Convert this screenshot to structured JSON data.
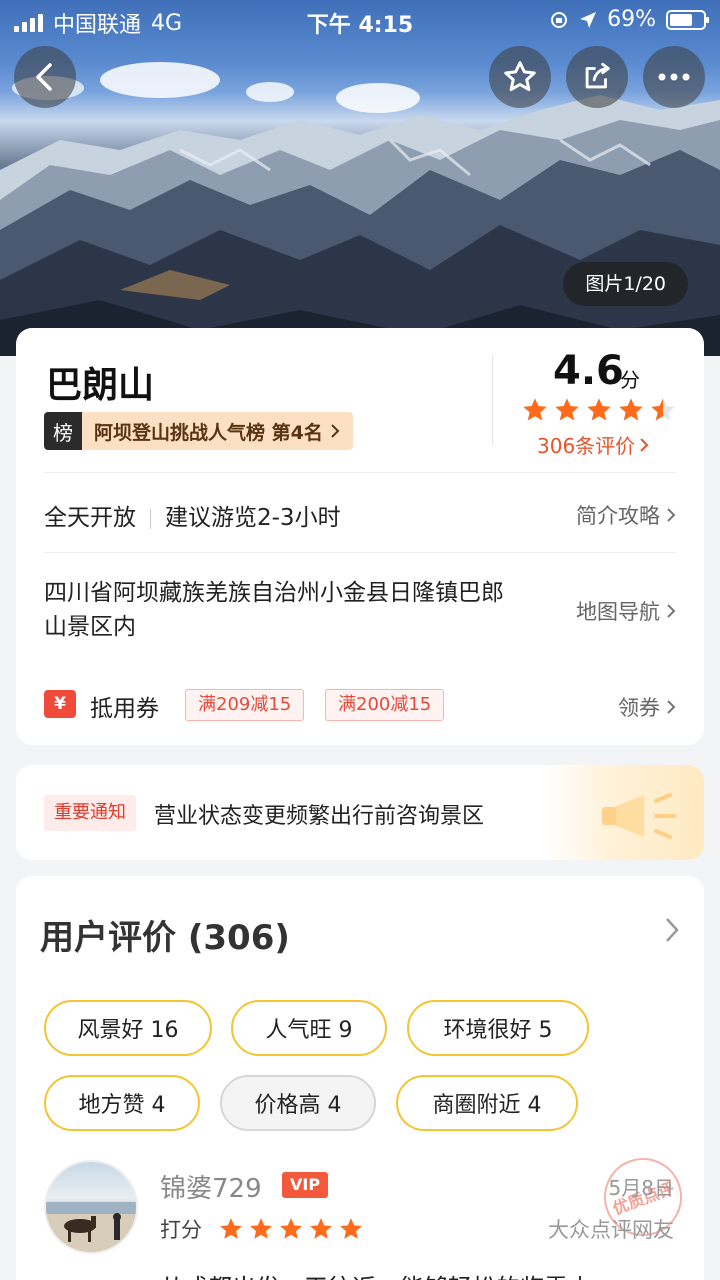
{
  "status_bar": {
    "carrier": "中国联通",
    "network": "4G",
    "time": "下午 4:15",
    "battery": "69%",
    "battery_level": 0.69
  },
  "header": {
    "photo_counter": "图片1/20"
  },
  "attraction": {
    "name": "巴朗山",
    "rank_tag": "榜",
    "rank_text": "阿坝登山挑战人气榜 第4名",
    "score": "4.6",
    "score_unit": "分",
    "rating_stars": 4.5,
    "review_count": "306条评价",
    "hours": "全天开放",
    "suggested_duration": "建议游览2-3小时",
    "intro_link": "简介攻略",
    "address": "四川省阿坝藏族羌族自治州小金县日隆镇巴郎山景区内",
    "map_link": "地图导航",
    "coupon_icon": "¥",
    "coupon_label": "抵用券",
    "coupons": [
      "满209减15",
      "满200减15"
    ],
    "claim_link": "领券"
  },
  "notice": {
    "tag": "重要通知",
    "text": "营业状态变更频繁出行前咨询景区"
  },
  "reviews": {
    "title": "用户评价 (306)",
    "tags": [
      {
        "label": "风景好 16"
      },
      {
        "label": "人气旺 9"
      },
      {
        "label": "环境很好 5"
      },
      {
        "label": "地方赞 4"
      },
      {
        "label": "价格高 4",
        "negative": true
      },
      {
        "label": "商圈附近 4"
      }
    ],
    "first": {
      "username": "锦婆729",
      "badge": "VIP",
      "rate_label": "打分",
      "stars": 5,
      "date": "5月8日",
      "source": "大众点评网友",
      "stamp": "优质点评",
      "text": "从成都出发，天往返，能够轻松的临雪山"
    }
  },
  "colors": {
    "accent": "#ff6a2b",
    "star": "#ff6b1a",
    "vip": "#f35a3c",
    "tag_border": "#f3c533"
  }
}
